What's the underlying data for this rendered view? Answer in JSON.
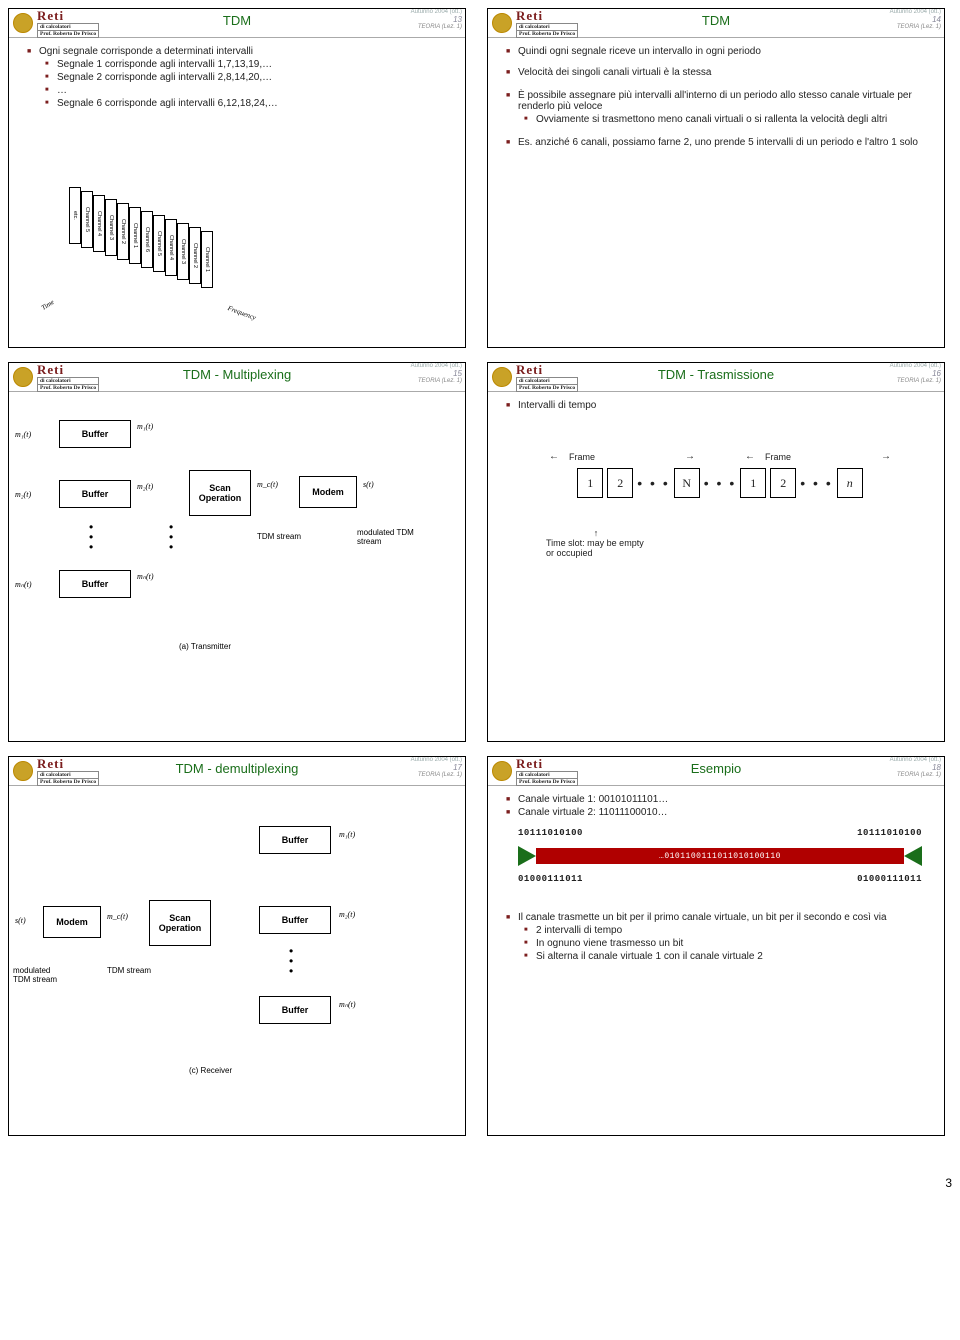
{
  "brand": "Reti",
  "brand_sub1": "di calcolatori",
  "brand_sub2": "Prof. Roberto De Prisco",
  "course": "Autunno 2004 (ott.)",
  "footer": "TEORIA (Lez. 1)",
  "page_number": "3",
  "s13": {
    "title": "TDM",
    "num": "13",
    "b1": "Ogni segnale corrisponde a determinati intervalli",
    "b1a": "Segnale 1 corrisponde agli intervalli 1,7,13,19,…",
    "b1b": "Segnale 2 corrisponde agli intervalli 2,8,14,20,…",
    "b1c": "…",
    "b1d": "Segnale 6 corrisponde agli intervalli 6,12,18,24,…",
    "ch": "Channel",
    "etc": "etc.",
    "time": "Time",
    "freq": "Frequency"
  },
  "s14": {
    "title": "TDM",
    "num": "14",
    "b1": "Quindi ogni segnale riceve un intervallo in ogni periodo",
    "b2": "Velocità dei singoli canali virtuali è la stessa",
    "b3": "È possibile assegnare più intervalli all'interno di un periodo allo stesso canale virtuale per renderlo più veloce",
    "b3a": "Ovviamente si trasmettono meno canali virtuali o si rallenta la velocità degli altri",
    "b4": "Es. anziché 6 canali, possiamo farne 2, uno prende 5 intervalli di un periodo e l'altro 1 solo"
  },
  "s15": {
    "title": "TDM - Multiplexing",
    "num": "15",
    "buffer": "Buffer",
    "scan": "Scan Operation",
    "modem": "Modem",
    "tdm_s": "TDM stream",
    "mod_s": "modulated TDM stream",
    "m1": "m₁(t)",
    "m2": "m₂(t)",
    "mn": "mₙ(t)",
    "mc": "m_c(t)",
    "s": "s(t)",
    "cap": "(a) Transmitter"
  },
  "s16": {
    "title": "TDM - Trasmissione",
    "num": "16",
    "b1": "Intervalli di tempo",
    "frame": "Frame",
    "c1": "1",
    "c2": "2",
    "cN": "N",
    "cn": "n",
    "slot": "Time slot: may be empty or occupied"
  },
  "s17": {
    "title": "TDM - demultiplexing",
    "num": "17",
    "buffer": "Buffer",
    "scan": "Scan Operation",
    "modem": "Modem",
    "tdm_s": "TDM stream",
    "mod_s": "modulated TDM stream",
    "m1": "m₁(t)",
    "m2": "m₂(t)",
    "mn": "mₙ(t)",
    "mc": "m_c(t)",
    "s": "s(t)",
    "cap": "(c) Receiver"
  },
  "s18": {
    "title": "Esempio",
    "num": "18",
    "b1": "Canale virtuale 1:  00101011101…",
    "b2": "Canale virtuale 2:  11011100010…",
    "bits1": "10111010100",
    "bits2": "01000111011",
    "wire": "…0101100111011010100110",
    "c1": "Il canale trasmette un bit per il primo canale virtuale, un bit per il secondo e così via",
    "c1a": "2 intervalli di tempo",
    "c1b": "In ognuno viene trasmesso un bit",
    "c1c": "Si alterna il canale virtuale 1 con il canale virtuale 2"
  }
}
